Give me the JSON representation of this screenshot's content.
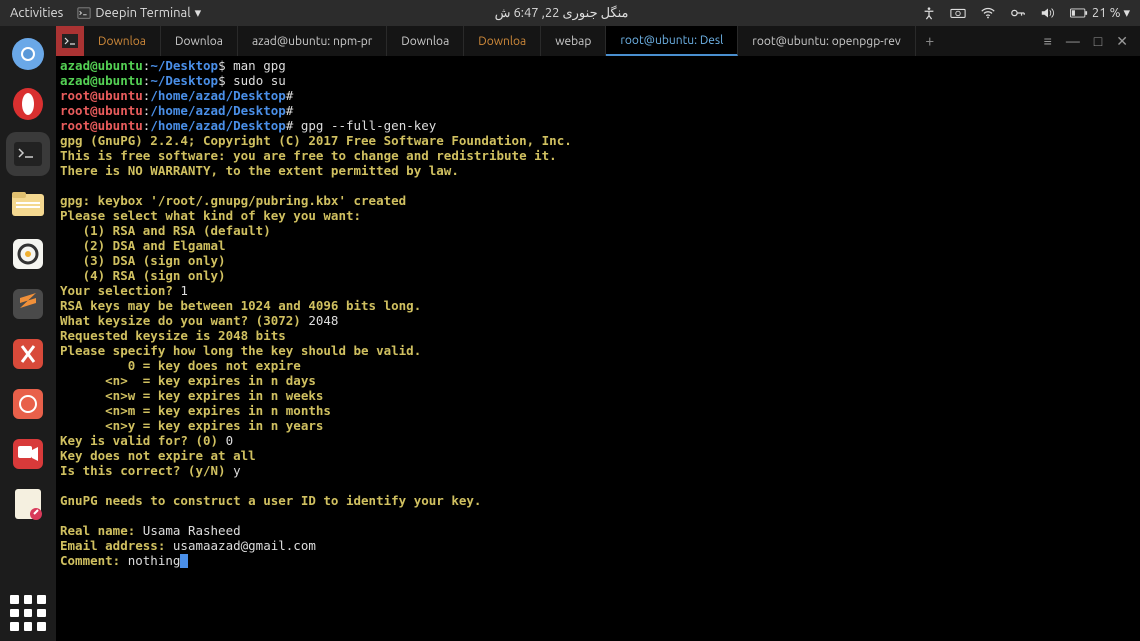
{
  "topbar": {
    "activities": "Activities",
    "appname": "Deepin Terminal",
    "datetime": "منگل جنوری 22, 6:47 ش",
    "battery": "21 % ▾"
  },
  "dock": {
    "items": [
      "chromium",
      "opera",
      "terminal",
      "files",
      "rhythmbox",
      "sublime",
      "app1",
      "app2",
      "recorder",
      "notes"
    ]
  },
  "tabs": {
    "items": [
      {
        "label": "Downloa",
        "mod": true
      },
      {
        "label": "Downloa",
        "mod": false
      },
      {
        "label": "azad@ubuntu: npm-pr",
        "mod": false
      },
      {
        "label": "Downloa",
        "mod": false
      },
      {
        "label": "Downloa",
        "mod": true
      },
      {
        "label": "webap",
        "mod": false
      },
      {
        "label": "root@ubuntu: Desl",
        "mod": false,
        "active": true
      },
      {
        "label": "root@ubuntu: openpgp-rev",
        "mod": false
      }
    ]
  },
  "term": {
    "p1_user": "azad@ubuntu",
    "p1_path": "~/Desktop",
    "p1_cmd": "man gpg",
    "p2_user": "azad@ubuntu",
    "p2_path": "~/Desktop",
    "p2_cmd": "sudo su",
    "p3_user": "root@ubuntu",
    "p3_path": "/home/azad/Desktop",
    "p4_user": "root@ubuntu",
    "p4_path": "/home/azad/Desktop",
    "p5_user": "root@ubuntu",
    "p5_path": "/home/azad/Desktop",
    "p5_cmd": "gpg --full-gen-key",
    "l_gpgver": "gpg (GnuPG) 2.2.4; Copyright (C) 2017 Free Software Foundation, Inc.",
    "l_free": "This is free software: you are free to change and redistribute it.",
    "l_nowar": "There is NO WARRANTY, to the extent permitted by law.",
    "l_keybox": "gpg: keybox '/root/.gnupg/pubring.kbx' created",
    "l_select": "Please select what kind of key you want:",
    "l_opt1": "   (1) RSA and RSA (default)",
    "l_opt2": "   (2) DSA and Elgamal",
    "l_opt3": "   (3) DSA (sign only)",
    "l_opt4": "   (4) RSA (sign only)",
    "l_yoursel": "Your selection? ",
    "l_yoursel_in": "1",
    "l_rsarange": "RSA keys may be between 1024 and 4096 bits long.",
    "l_keysize": "What keysize do you want? (3072) ",
    "l_keysize_in": "2048",
    "l_req": "Requested keysize is 2048 bits",
    "l_valid": "Please specify how long the key should be valid.",
    "l_v0": "         0 = key does not expire",
    "l_vn": "      <n>  = key expires in n days",
    "l_vw": "      <n>w = key expires in n weeks",
    "l_vm": "      <n>m = key expires in n months",
    "l_vy": "      <n>y = key expires in n years",
    "l_kvalid": "Key is valid for? (0) ",
    "l_kvalid_in": "0",
    "l_noexp": "Key does not expire at all",
    "l_correct": "Is this correct? (y/N) ",
    "l_correct_in": "y",
    "l_uid": "GnuPG needs to construct a user ID to identify your key.",
    "l_name": "Real name: ",
    "l_name_in": "Usama Rasheed",
    "l_email": "Email address: ",
    "l_email_in": "usamaazad@gmail.com",
    "l_comment": "Comment: ",
    "l_comment_in": "nothing"
  }
}
